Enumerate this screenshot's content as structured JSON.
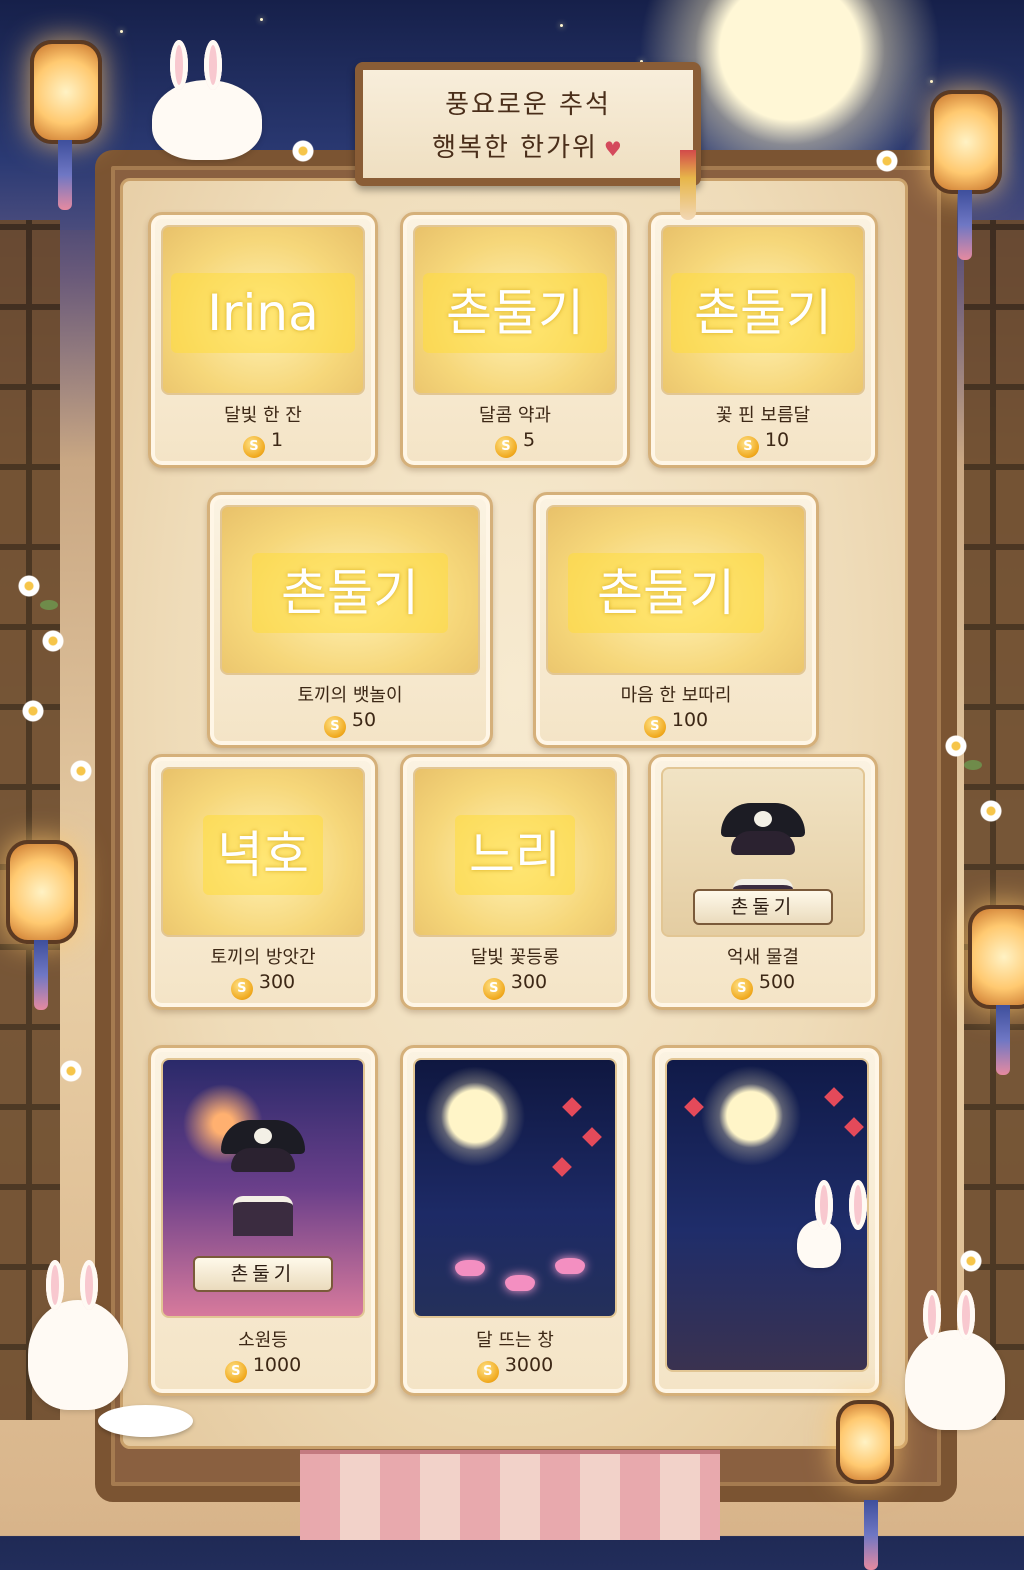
{
  "banner": {
    "line1": "풍요로운 추석",
    "line2": "행복한 한가위",
    "heart": "♥"
  },
  "currency_icon": "S",
  "cards": [
    {
      "name": "달빛 한 잔",
      "price": "1",
      "overlay": "Irina",
      "art": "moon-cup"
    },
    {
      "name": "달콤 약과",
      "price": "5",
      "overlay": "촌둘기",
      "art": "yakgwa"
    },
    {
      "name": "꽃 핀 보름달",
      "price": "10",
      "overlay": "촌둘기",
      "art": "flower-moon"
    },
    {
      "name": "토끼의 뱃놀이",
      "price": "50",
      "overlay": "촌둘기",
      "art": "rabbit-boat"
    },
    {
      "name": "마음 한 보따리",
      "price": "100",
      "overlay": "촌둘기",
      "art": "gift-box"
    },
    {
      "name": "토끼의 방앗간",
      "price": "300",
      "overlay": "녁호",
      "art": "rabbit-mill"
    },
    {
      "name": "달빛 꽃등롱",
      "price": "300",
      "overlay": "느리",
      "art": "flower-lantern"
    },
    {
      "name": "억새 물결",
      "price": "500",
      "scroll": "촌둘기",
      "art": "pirate"
    },
    {
      "name": "소원등",
      "price": "1000",
      "scroll": "촌둘기",
      "art": "pirate"
    },
    {
      "name": "달 뜨는 창",
      "price": "3000",
      "art": "moon-window"
    },
    {
      "art": "moon-bridge"
    }
  ],
  "colors": {
    "frame": "#7b5432",
    "parchment": "#f2e2c2",
    "overlay": "#ffdc3c",
    "coin": "#f0a81c",
    "night": "#1d2a66"
  }
}
